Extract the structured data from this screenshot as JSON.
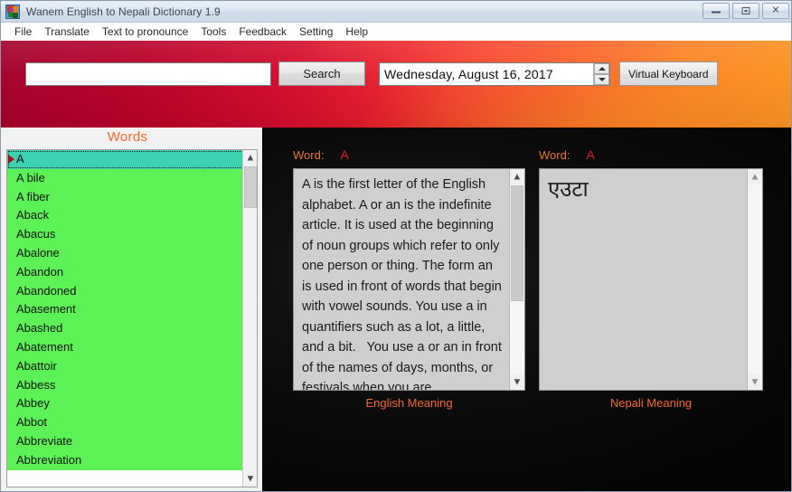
{
  "window": {
    "title": "Wanem  English to Nepali Dictionary 1.9",
    "icon": "app-icon",
    "controls": [
      {
        "name": "minimize",
        "glyph": "minimize-icon"
      },
      {
        "name": "maximize",
        "glyph": "maximize-icon"
      },
      {
        "name": "close",
        "glyph": "close-icon",
        "label": "✕"
      }
    ]
  },
  "menubar": {
    "items": [
      {
        "label": "File"
      },
      {
        "label": "Translate"
      },
      {
        "label": "Text to pronounce"
      },
      {
        "label": "Tools"
      },
      {
        "label": "Feedback"
      },
      {
        "label": "Setting"
      },
      {
        "label": "Help"
      }
    ]
  },
  "header": {
    "search": {
      "value": "",
      "placeholder": ""
    },
    "search_button": "Search",
    "date": {
      "weekday": "Wednesday,",
      "month": "August",
      "day_year": "16, 2017",
      "full": "Wednesday,     August     16, 2017"
    },
    "virtual_keyboard_button": "Virtual Keyboard",
    "gradient_start": "#a4002a",
    "gradient_end": "#fb9420"
  },
  "words_panel": {
    "title": "Words",
    "title_color": "#f4692b",
    "selected_index": 0,
    "row_background": "#5cf255",
    "selected_background": "#3cd1b0",
    "items": [
      "A",
      "A bile",
      "A fiber",
      "Aback",
      "Abacus",
      "Abalone",
      "Abandon",
      "Abandoned",
      "Abasement",
      "Abashed",
      "Abatement",
      "Abattoir",
      "Abbess",
      "Abbey",
      "Abbot",
      "Abbreviate",
      "Abbreviation"
    ],
    "scroll_up_icon": "chevron-up-icon",
    "scroll_down_icon": "chevron-down-icon"
  },
  "english_panel": {
    "word_key": "Word:",
    "word_value": "A",
    "meaning": "A is the first letter of the English alphabet. A or an is the indefinite article. It is used at the beginning of noun groups which refer to only one person or thing. The form an is used in front of words that begin with vowel sounds. You use a in quantifiers such as a lot, a little, and a bit.   You use a or an in front of the names of days, months, or festivals when you are",
    "bottom_label": "English Meaning",
    "scroll_up_icon": "chevron-up-icon",
    "scroll_down_icon": "chevron-down-icon"
  },
  "nepali_panel": {
    "word_key": "Word:",
    "word_value": "A",
    "meaning": "एउटा",
    "bottom_label": "Nepali Meaning",
    "scroll_up_icon": "chevron-up-icon",
    "scroll_down_icon": "chevron-down-icon"
  }
}
